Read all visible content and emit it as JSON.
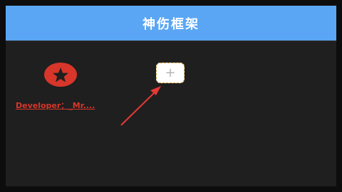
{
  "titlebar": {
    "title": "神伤框架",
    "color": "#5aa6f4"
  },
  "apps": [
    {
      "label": "Developer：_Mr....",
      "icon": "star-icon",
      "color": "#d8362a"
    }
  ],
  "add_button": {
    "icon": "plus-icon",
    "glyph": "+"
  },
  "annotation": {
    "icon": "red-arrow-pointer",
    "color": "#e53935"
  }
}
